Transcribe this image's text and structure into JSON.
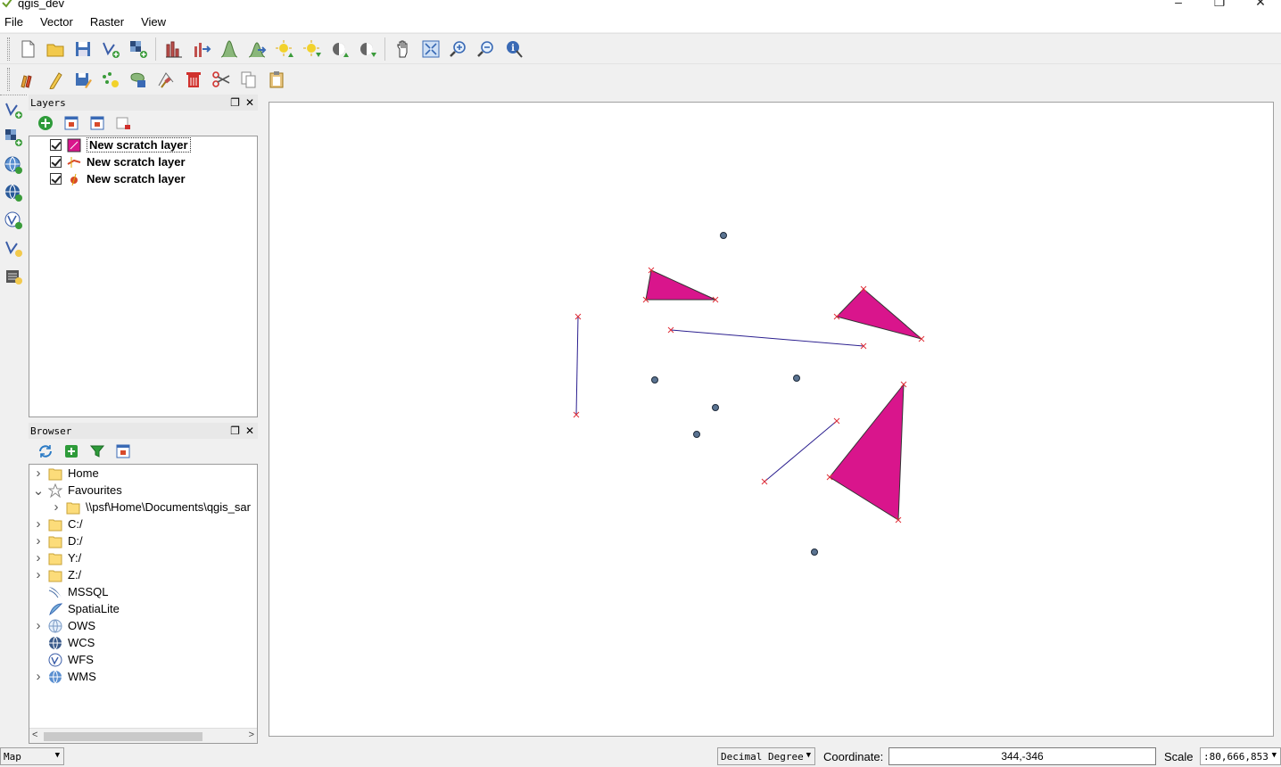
{
  "window": {
    "title": "qgis_dev",
    "minimize": "–",
    "maximize": "❐",
    "close": "✕"
  },
  "menu": [
    "File",
    "Vector",
    "Raster",
    "View"
  ],
  "layers_panel": {
    "title": "Layers",
    "layers": [
      {
        "name": "New scratch layer",
        "checked": true,
        "geometry": "polygon"
      },
      {
        "name": "New scratch layer",
        "checked": true,
        "geometry": "line"
      },
      {
        "name": "New scratch layer",
        "checked": true,
        "geometry": "point"
      }
    ]
  },
  "browser_panel": {
    "title": "Browser",
    "items": [
      {
        "label": "Home",
        "expand": ">",
        "icon": "folder-icon"
      },
      {
        "label": "Favourites",
        "expand": "v",
        "icon": "star-icon"
      },
      {
        "label": "\\\\psf\\Home\\Documents\\qgis_sar",
        "expand": ">",
        "icon": "folder-icon"
      },
      {
        "label": "C:/",
        "expand": ">",
        "icon": "folder-icon"
      },
      {
        "label": "D:/",
        "expand": ">",
        "icon": "folder-icon"
      },
      {
        "label": "Y:/",
        "expand": ">",
        "icon": "folder-icon"
      },
      {
        "label": "Z:/",
        "expand": ">",
        "icon": "folder-icon"
      },
      {
        "label": "MSSQL",
        "expand": "",
        "icon": "mssql-icon"
      },
      {
        "label": "SpatiaLite",
        "expand": "",
        "icon": "spatialite-icon"
      },
      {
        "label": "OWS",
        "expand": ">",
        "icon": "ows-icon"
      },
      {
        "label": "WCS",
        "expand": "",
        "icon": "wcs-icon"
      },
      {
        "label": "WFS",
        "expand": "",
        "icon": "wfs-icon"
      },
      {
        "label": "WMS",
        "expand": ">",
        "icon": "wms-icon"
      }
    ]
  },
  "statusbar": {
    "map_combo": "Map",
    "crs_format": "Decimal Degree",
    "coordinate_label": "Coordinate:",
    "coordinate_value": "344,-346",
    "scale_label": "Scale",
    "scale_value": ":80,666,853"
  },
  "colors": {
    "polygon_fill": "#d9158c",
    "line": "#2b1f8f",
    "vertex": "#e0303a",
    "point": "#5a7391"
  }
}
